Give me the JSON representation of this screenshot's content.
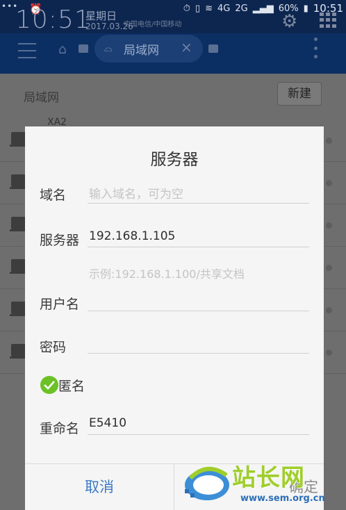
{
  "status_bar": {
    "dots": "•••",
    "clock": "10:51",
    "weekday": "星期日",
    "date": "2017.03.26",
    "carrier": "中国电信/中国移动",
    "network": "4G",
    "signal2": "2G",
    "battery": "60%",
    "time": "10:51"
  },
  "app_bar": {
    "tab_title": "局域网",
    "tab_close": "×"
  },
  "background": {
    "header": "局域网",
    "new_button": "新建",
    "first_row_label": "XA2"
  },
  "dialog": {
    "title": "服务器",
    "domain": {
      "label": "域名",
      "placeholder": "输入域名，可为空",
      "value": ""
    },
    "server": {
      "label": "服务器",
      "value": "192.168.1.105",
      "hint": "示例:192.168.1.100/共享文档"
    },
    "username": {
      "label": "用户名",
      "value": ""
    },
    "password": {
      "label": "密码",
      "value": ""
    },
    "anonymous": {
      "label": "匿名",
      "checked": true
    },
    "rename": {
      "label": "重命名",
      "value": "E5410"
    },
    "cancel_button": "取消",
    "ok_button": "确定"
  },
  "watermark": {
    "title": "站长网",
    "url": "www.sem.org.cn"
  },
  "colors": {
    "accent_blue": "#3d7ac4",
    "check_green": "#6cc126",
    "app_bar": "#0b2f63"
  }
}
